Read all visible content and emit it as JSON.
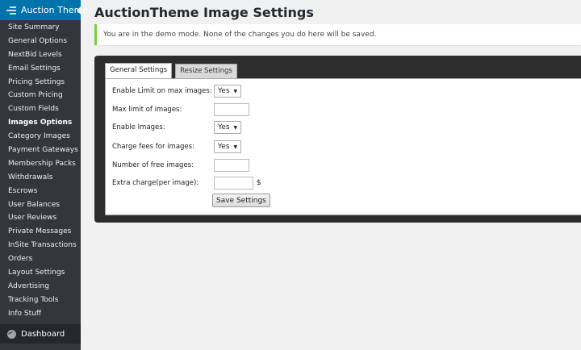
{
  "sidebar": {
    "header": {
      "icon": "list-icon",
      "title": "Auction Theme"
    },
    "items": [
      {
        "label": "Site Summary"
      },
      {
        "label": "General Options"
      },
      {
        "label": "NextBid Levels"
      },
      {
        "label": "Email Settings"
      },
      {
        "label": "Pricing Settings"
      },
      {
        "label": "Custom Pricing"
      },
      {
        "label": "Custom Fields"
      },
      {
        "label": "Images Options"
      },
      {
        "label": "Category Images"
      },
      {
        "label": "Payment Gateways"
      },
      {
        "label": "Membership Packs"
      },
      {
        "label": "Withdrawals"
      },
      {
        "label": "Escrows"
      },
      {
        "label": "User Balances"
      },
      {
        "label": "User Reviews"
      },
      {
        "label": "Private Messages"
      },
      {
        "label": "InSite Transactions"
      },
      {
        "label": "Orders"
      },
      {
        "label": "Layout Settings"
      },
      {
        "label": "Advertising"
      },
      {
        "label": "Tracking Tools"
      },
      {
        "label": "Info Stuff"
      }
    ],
    "active_item": "Images Options",
    "dashboard": {
      "icon": "dashboard-gauge-icon",
      "label": "Dashboard"
    }
  },
  "page": {
    "title": "AuctionTheme Image Settings",
    "notice": "You are in the demo mode. None of the changes you do here will be saved."
  },
  "tabs": [
    {
      "label": "General Settings",
      "active": true
    },
    {
      "label": "Resize Settings",
      "active": false
    }
  ],
  "form": {
    "enable_limit": {
      "label": "Enable Limit on max images:",
      "value": "Yes"
    },
    "max_limit": {
      "label": "Max limit of images:",
      "value": ""
    },
    "enable_images": {
      "label": "Enable Images:",
      "value": "Yes"
    },
    "charge_fees": {
      "label": "Charge fees for images:",
      "value": "Yes"
    },
    "free_images": {
      "label": "Number of free images:",
      "value": ""
    },
    "extra_charge": {
      "label": "Extra charge(per image):",
      "value": "",
      "unit": "$"
    },
    "save_label": "Save Settings"
  },
  "colors": {
    "sidebar_bg": "#32373c",
    "sidebar_header_bg": "#0073aa",
    "notice_accent": "#7ad03a",
    "panel_bg": "#2d2d2d"
  }
}
